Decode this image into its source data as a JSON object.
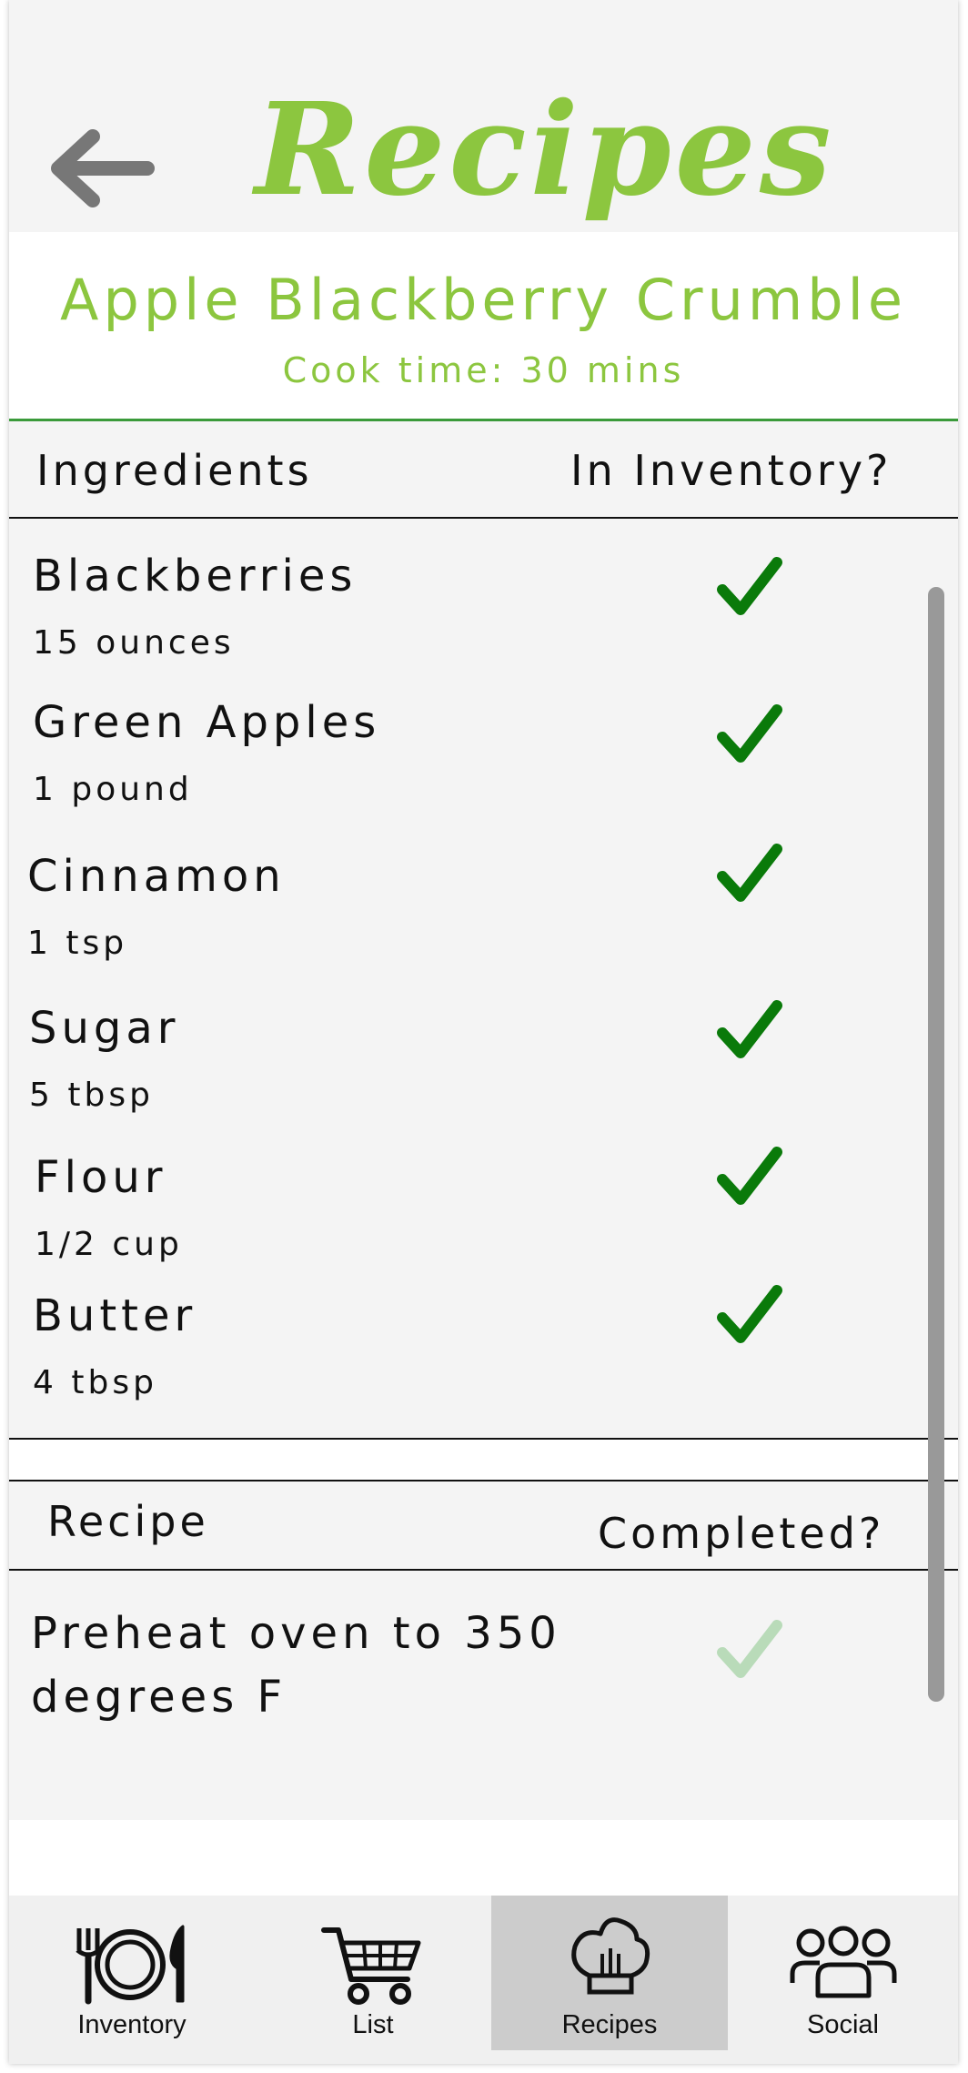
{
  "header": {
    "title": "Recipes",
    "back_icon": "back-arrow-icon"
  },
  "recipe": {
    "name": "Apple Blackberry Crumble",
    "cook_time": "Cook time: 30 mins"
  },
  "ingredients_section": {
    "col_left": "Ingredients",
    "col_right": "In Inventory?",
    "items": [
      {
        "name": "Blackberries",
        "qty": "15 ounces",
        "in_inventory": true
      },
      {
        "name": "Green Apples",
        "qty": "1 pound",
        "in_inventory": true
      },
      {
        "name": "Cinnamon",
        "qty": "1 tsp",
        "in_inventory": true
      },
      {
        "name": "Sugar",
        "qty": "5 tbsp",
        "in_inventory": true
      },
      {
        "name": "Flour",
        "qty": "1/2 cup",
        "in_inventory": true
      },
      {
        "name": "Butter",
        "qty": "4 tbsp",
        "in_inventory": true
      }
    ]
  },
  "recipe_section": {
    "col_left": "Recipe",
    "col_right": "Completed?",
    "steps": [
      {
        "text": "Preheat oven to 350 degrees F",
        "completed": false
      }
    ]
  },
  "nav": {
    "items": [
      {
        "label": "Inventory",
        "icon": "plate-cutlery-icon",
        "active": false
      },
      {
        "label": "List",
        "icon": "shopping-cart-icon",
        "active": false
      },
      {
        "label": "Recipes",
        "icon": "chef-hat-icon",
        "active": true
      },
      {
        "label": "Social",
        "icon": "people-group-icon",
        "active": false
      }
    ]
  },
  "colors": {
    "accent_green": "#8cc63f",
    "check_green": "#0a7a0a",
    "check_faded": "#b9dbb9",
    "active_tab_bg": "#cccccc",
    "scrollbar": "#999999"
  }
}
